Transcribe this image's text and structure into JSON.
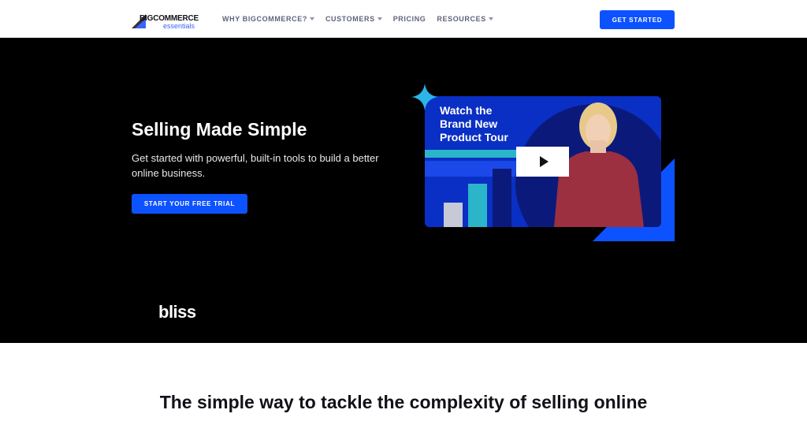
{
  "header": {
    "logo": {
      "big": "BIG",
      "commerce": "COMMERCE",
      "sub": "essentials"
    },
    "nav": [
      {
        "label": "WHY BIGCOMMERCE?",
        "dropdown": true
      },
      {
        "label": "CUSTOMERS",
        "dropdown": true
      },
      {
        "label": "PRICING",
        "dropdown": false
      },
      {
        "label": "RESOURCES",
        "dropdown": true
      }
    ],
    "cta_label": "GET STARTED"
  },
  "hero": {
    "title": "Selling Made Simple",
    "subtitle": "Get started with powerful, built-in tools to build a better online business.",
    "cta_label": "START YOUR FREE TRIAL",
    "video": {
      "title_line1": "Watch the",
      "title_line2": "Brand New",
      "title_line3": "Product Tour"
    },
    "customer_logo": "bliss"
  },
  "section": {
    "title": "The simple way to tackle the complexity of selling online"
  },
  "colors": {
    "accent": "#0d52ff",
    "hero_bg": "#000000",
    "video_bg": "#0a2fc4",
    "teal": "#2bb5c8"
  },
  "icons": {
    "logo": "bigcommerce-logo-icon",
    "play": "play-icon",
    "sparkle": "sparkle-icon",
    "caret": "chevron-down-icon"
  }
}
